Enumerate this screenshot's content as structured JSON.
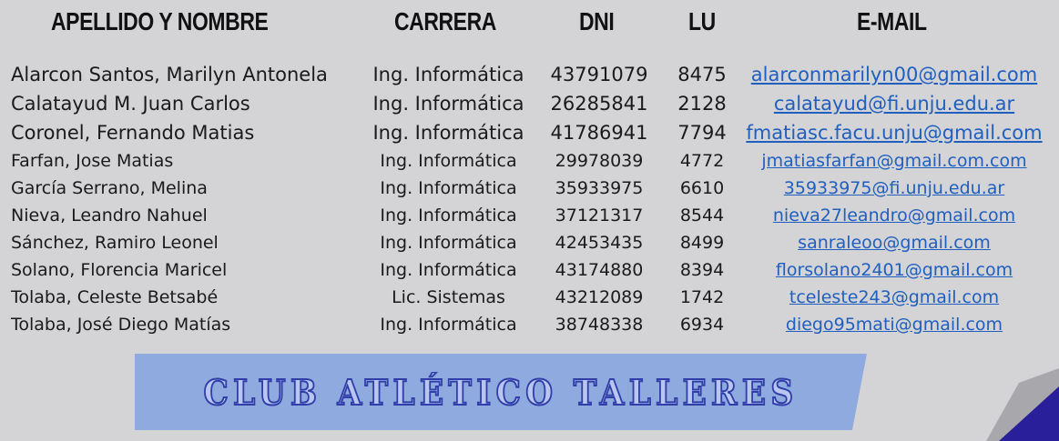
{
  "header": {
    "name": "APELLIDO Y NOMBRE",
    "career": "CARRERA",
    "dni": "DNI",
    "lu": "LU",
    "email": "E-MAIL"
  },
  "rows": [
    {
      "name": "Alarcon Santos, Marilyn Antonela",
      "career": "Ing. Informática",
      "dni": "43791079",
      "lu": "8475",
      "email": "alarconmarilyn00@gmail.com"
    },
    {
      "name": "Calatayud M. Juan Carlos",
      "career": "Ing. Informática",
      "dni": "26285841",
      "lu": "2128",
      "email": "calatayud@fi.unju.edu.ar"
    },
    {
      "name": "Coronel, Fernando Matias",
      "career": "Ing. Informática",
      "dni": "41786941",
      "lu": "7794",
      "email": "fmatiasc.facu.unju@gmail.com"
    },
    {
      "name": "Farfan, Jose Matias",
      "career": "Ing. Informática",
      "dni": "29978039",
      "lu": "4772",
      "email": "jmatiasfarfan@gmail.com.com"
    },
    {
      "name": "García Serrano, Melina",
      "career": "Ing. Informática",
      "dni": "35933975",
      "lu": "6610",
      "email": "35933975@fi.unju.edu.ar"
    },
    {
      "name": "Nieva, Leandro Nahuel",
      "career": "Ing. Informática",
      "dni": "37121317",
      "lu": "8544",
      "email": "nieva27leandro@gmail.com"
    },
    {
      "name": "Sánchez, Ramiro Leonel",
      "career": "Ing. Informática",
      "dni": "42453435",
      "lu": "8499",
      "email": "sanraleoo@gmail.com"
    },
    {
      "name": "Solano, Florencia Maricel",
      "career": "Ing. Informática",
      "dni": "43174880",
      "lu": "8394",
      "email": "florsolano2401@gmail.com"
    },
    {
      "name": "Tolaba, Celeste Betsabé",
      "career": "Lic. Sistemas",
      "dni": "43212089",
      "lu": "1742",
      "email": "tceleste243@gmail.com"
    },
    {
      "name": "Tolaba, José Diego Matías",
      "career": "Ing. Informática",
      "dni": "38748338",
      "lu": "6934",
      "email": "diego95mati@gmail.com"
    }
  ],
  "banner": {
    "title": "CLUB ATLÉTICO TALLERES"
  },
  "colors": {
    "background": "#d4d3d6",
    "banner": "#8faadf",
    "link": "#1f5fc0",
    "corner_accent": "#2a1f9a"
  }
}
